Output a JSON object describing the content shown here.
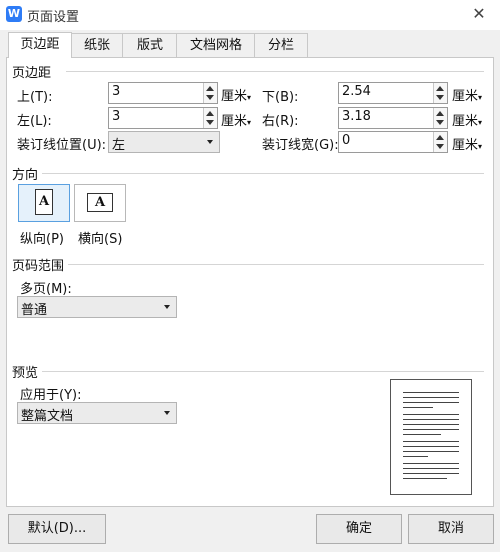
{
  "window": {
    "title": "页面设置",
    "logo_letter": "W"
  },
  "tabs": [
    {
      "label": "页边距",
      "active": true
    },
    {
      "label": "纸张",
      "active": false
    },
    {
      "label": "版式",
      "active": false
    },
    {
      "label": "文档网格",
      "active": false
    },
    {
      "label": "分栏",
      "active": false
    }
  ],
  "margins": {
    "section_title": "页边距",
    "top": {
      "label": "上(T):",
      "value": "3",
      "unit": "厘米"
    },
    "bottom": {
      "label": "下(B):",
      "value": "2.54",
      "unit": "厘米"
    },
    "left": {
      "label": "左(L):",
      "value": "3",
      "unit": "厘米"
    },
    "right": {
      "label": "右(R):",
      "value": "3.18",
      "unit": "厘米"
    },
    "gutter_pos": {
      "label": "装订线位置(U):",
      "value": "左"
    },
    "gutter_width": {
      "label": "装订线宽(G):",
      "value": "0",
      "unit": "厘米"
    }
  },
  "orientation": {
    "section_title": "方向",
    "portrait": {
      "label": "纵向(P)",
      "glyph": "A",
      "selected": true
    },
    "landscape": {
      "label": "横向(S)",
      "glyph": "A",
      "selected": false
    }
  },
  "pages": {
    "section_title": "页码范围",
    "multi_label": "多页(M):",
    "multi_value": "普通"
  },
  "preview": {
    "section_title": "预览",
    "apply_label": "应用于(Y):",
    "apply_value": "整篇文档"
  },
  "buttons": {
    "default": "默认(D)...",
    "ok": "确定",
    "cancel": "取消"
  },
  "colors": {
    "accent": "#2e7cf6",
    "selected_border": "#5aa0e0",
    "selected_fill": "#e5f1fb"
  }
}
